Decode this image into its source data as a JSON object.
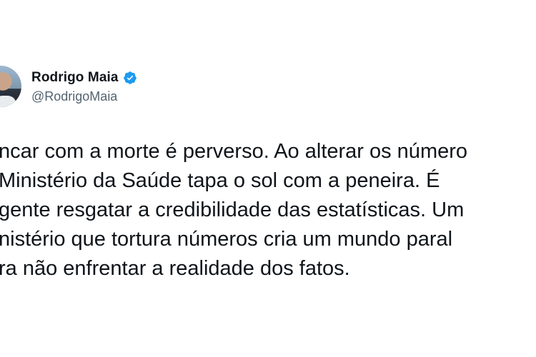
{
  "author": {
    "display_name": "Rodrigo Maia",
    "handle": "@RodrigoMaia",
    "verified": true
  },
  "tweet": {
    "lines": [
      "ncar com a morte é perverso. Ao alterar os número",
      "Ministério da Saúde tapa o sol com a peneira. É",
      "gente resgatar a credibilidade das estatísticas. Um",
      "nistério que tortura números cria um mundo paral",
      "ra não enfrentar a realidade dos fatos."
    ]
  },
  "icons": {
    "avatar": "user-avatar",
    "verified": "verified-badge-icon"
  },
  "colors": {
    "text": "#0f1419",
    "handle": "#536471",
    "verified": "#1d9bf0"
  }
}
